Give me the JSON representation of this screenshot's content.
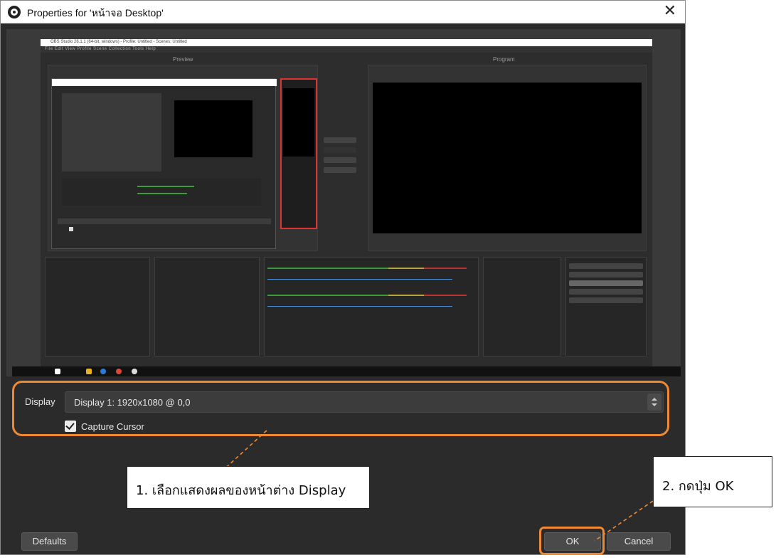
{
  "window": {
    "title": "Properties for 'หน้าจอ Desktop'",
    "close_glyph": "✕"
  },
  "preview": {
    "obs_title": "OBS Studio 26.1.1 (64-bit, windows) - Profile: Untitled - Scenes: Untitled",
    "obs_menu": "File   Edit   View   Profile   Scene Collection   Tools   Help",
    "preview_label": "Preview",
    "program_label": "Program"
  },
  "display": {
    "label": "Display",
    "value": "Display 1: 1920x1080 @ 0,0"
  },
  "capture_cursor": {
    "label": "Capture Cursor",
    "checked": true
  },
  "buttons": {
    "defaults": "Defaults",
    "ok": "OK",
    "cancel": "Cancel"
  },
  "annotations": {
    "callout_1": "1. เลือกแสดงผลของหน้าต่าง Display",
    "callout_2": "2. กดปุ่ม OK",
    "highlight_color": "#ef8a32"
  },
  "icons": {
    "app": "obs-logo-icon",
    "close": "close-icon",
    "checkbox": "checkmark-icon",
    "spinner": "spin-updown-icon"
  }
}
